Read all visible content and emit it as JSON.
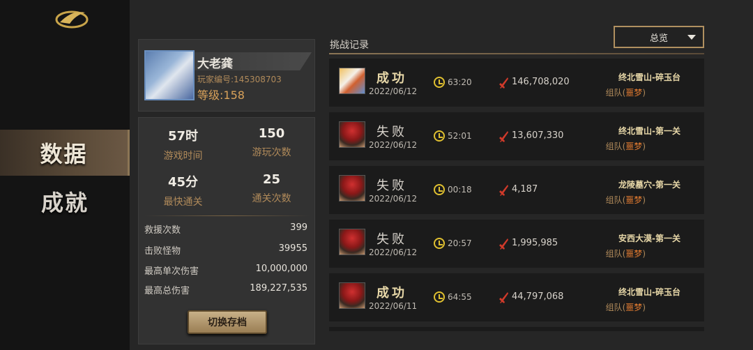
{
  "nav": {
    "items": [
      {
        "label": "数据",
        "active": true
      },
      {
        "label": "成就",
        "active": false
      }
    ]
  },
  "profile": {
    "name": "大老龚",
    "player_id": "玩家编号:145308703",
    "level": "等级:158"
  },
  "stats": {
    "grid": [
      {
        "value": "57时",
        "label": "游戏时间"
      },
      {
        "value": "150",
        "label": "游玩次数"
      },
      {
        "value": "45分",
        "label": "最快通关"
      },
      {
        "value": "25",
        "label": "通关次数"
      }
    ],
    "details": [
      {
        "label": "救援次数",
        "value": "399"
      },
      {
        "label": "击败怪物",
        "value": "39955"
      },
      {
        "label": "最高单次伤害",
        "value": "10,000,000"
      },
      {
        "label": "最高总伤害",
        "value": "189,227,535"
      }
    ],
    "switch_button": "切换存档"
  },
  "records": {
    "title": "挑战记录",
    "filter": "总览",
    "items": [
      {
        "result": "成功",
        "win": true,
        "date": "2022/06/12",
        "time": "63:20",
        "damage": "146,708,020",
        "stage": "终北雪山-碎玉台",
        "team": "组队(",
        "difficulty": "噩梦",
        "team_close": ")",
        "avatar": "tiger"
      },
      {
        "result": "失败",
        "win": false,
        "date": "2022/06/12",
        "time": "52:01",
        "damage": "13,607,330",
        "stage": "终北雪山-第一关",
        "team": "组队(",
        "difficulty": "噩梦",
        "team_close": ")",
        "avatar": "red"
      },
      {
        "result": "失败",
        "win": false,
        "date": "2022/06/12",
        "time": "00:18",
        "damage": "4,187",
        "stage": "龙陵墓穴-第一关",
        "team": "组队(",
        "difficulty": "噩梦",
        "team_close": ")",
        "avatar": "red"
      },
      {
        "result": "失败",
        "win": false,
        "date": "2022/06/12",
        "time": "20:57",
        "damage": "1,995,985",
        "stage": "安西大漠-第一关",
        "team": "组队(",
        "difficulty": "噩梦",
        "team_close": ")",
        "avatar": "red"
      },
      {
        "result": "成功",
        "win": true,
        "date": "2022/06/11",
        "time": "64:55",
        "damage": "44,797,068",
        "stage": "终北雪山-碎玉台",
        "team": "组队(",
        "difficulty": "噩梦",
        "team_close": ")",
        "avatar": "red"
      }
    ]
  },
  "colors": {
    "accent_gold": "#b08a5a",
    "hard_orange": "#e07a30",
    "clock_yellow": "#e0c030",
    "damage_red": "#d03a2a"
  }
}
